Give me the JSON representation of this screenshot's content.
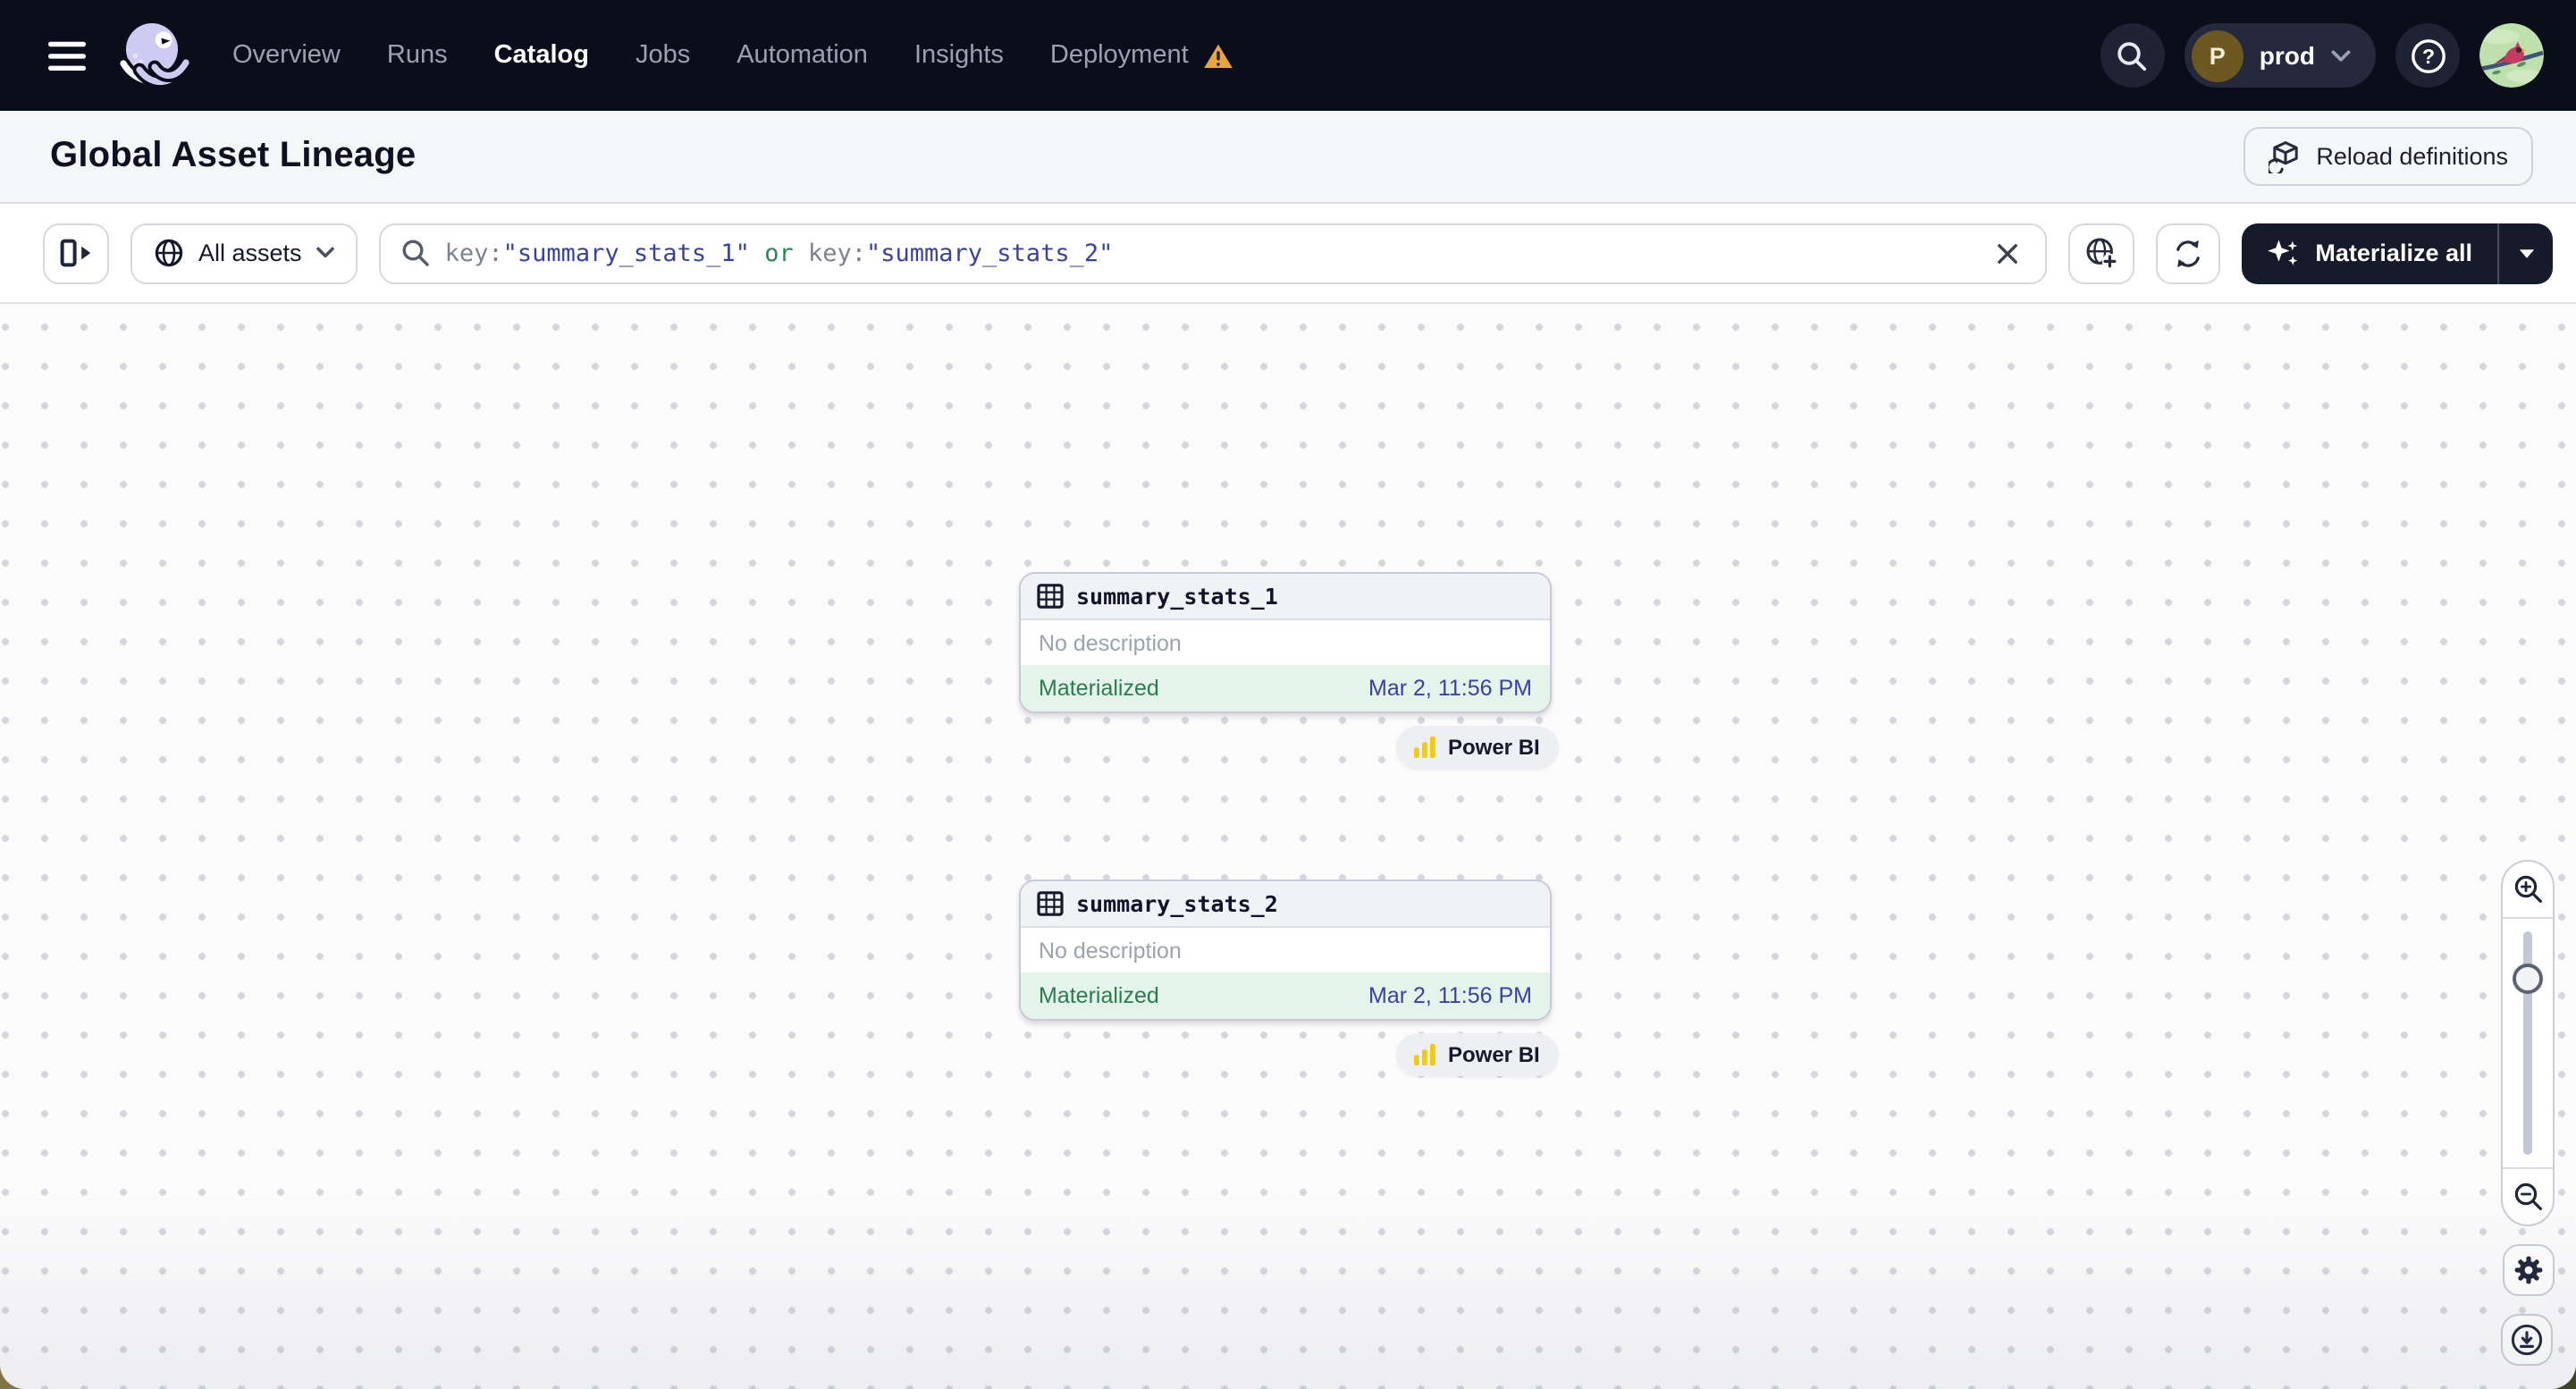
{
  "nav": {
    "items": [
      {
        "label": "Overview"
      },
      {
        "label": "Runs"
      },
      {
        "label": "Catalog"
      },
      {
        "label": "Jobs"
      },
      {
        "label": "Automation"
      },
      {
        "label": "Insights"
      },
      {
        "label": "Deployment"
      }
    ],
    "active_item": "Catalog",
    "env": {
      "initial": "P",
      "name": "prod"
    },
    "help_glyph": "?"
  },
  "header": {
    "title": "Global Asset Lineage",
    "reload_label": "Reload definitions"
  },
  "toolbar": {
    "scope_label": "All assets",
    "search_tokens": [
      {
        "text": "key:"
      },
      {
        "text": "\"summary_stats_1\""
      },
      {
        "text": " or "
      },
      {
        "text": "key:"
      },
      {
        "text": "\"summary_stats_2\""
      }
    ],
    "materialize_label": "Materialize all"
  },
  "canvas": {
    "nodes": [
      {
        "name": "summary_stats_1",
        "description": "No description",
        "status": "Materialized",
        "timestamp": "Mar 2, 11:56 PM",
        "tag": "Power BI"
      },
      {
        "name": "summary_stats_2",
        "description": "No description",
        "status": "Materialized",
        "timestamp": "Mar 2, 11:56 PM",
        "tag": "Power BI"
      }
    ]
  },
  "colors": {
    "nav_bg": "#0A0E1B",
    "indigo": "#3A41A5",
    "green": "#2B7D4F",
    "green_bg": "#E5F4EA",
    "amber": "#E9A43C",
    "powerbi_yellow": "#F3C912"
  }
}
